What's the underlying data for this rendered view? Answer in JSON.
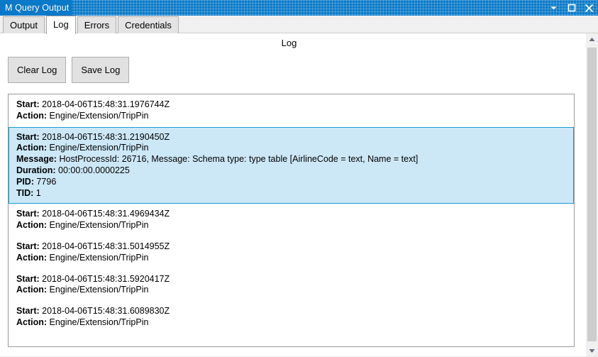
{
  "window": {
    "title": "M Query Output",
    "controls": [
      {
        "name": "minimize",
        "glyph": "chevron-down"
      },
      {
        "name": "maximize",
        "glyph": "square"
      },
      {
        "name": "close",
        "glyph": "x"
      }
    ],
    "colors": {
      "titlebar": "#0a7ac8",
      "titlebar_text": "#ffffff",
      "selection_fill": "#cce8f7",
      "selection_border": "#1d9bd7",
      "button_face": "#e1e1e1",
      "tab_inactive": "#e4e4e4",
      "tab_active": "#ffffff"
    }
  },
  "tabs": [
    {
      "label": "Output",
      "active": false
    },
    {
      "label": "Log",
      "active": true
    },
    {
      "label": "Errors",
      "active": false
    },
    {
      "label": "Credentials",
      "active": false
    }
  ],
  "panel": {
    "title": "Log",
    "buttons": [
      {
        "label": "Clear Log",
        "name": "clear-log-button"
      },
      {
        "label": "Save Log",
        "name": "save-log-button"
      }
    ]
  },
  "log_entries": [
    {
      "selected": false,
      "fields": [
        {
          "key": "Start:",
          "value": "2018-04-06T15:48:31.1976744Z"
        },
        {
          "key": "Action:",
          "value": "Engine/Extension/TripPin"
        }
      ]
    },
    {
      "selected": true,
      "fields": [
        {
          "key": "Start:",
          "value": "2018-04-06T15:48:31.2190450Z"
        },
        {
          "key": "Action:",
          "value": "Engine/Extension/TripPin"
        },
        {
          "key": "Message:",
          "value": "HostProcessId: 26716, Message: Schema type: type table [AirlineCode = text, Name = text]"
        },
        {
          "key": "Duration:",
          "value": "00:00:00.0000225"
        },
        {
          "key": "PID:",
          "value": "7796"
        },
        {
          "key": "TID:",
          "value": "1"
        }
      ]
    },
    {
      "selected": false,
      "fields": [
        {
          "key": "Start:",
          "value": "2018-04-06T15:48:31.4969434Z"
        },
        {
          "key": "Action:",
          "value": "Engine/Extension/TripPin"
        }
      ]
    },
    {
      "selected": false,
      "fields": [
        {
          "key": "Start:",
          "value": "2018-04-06T15:48:31.5014955Z"
        },
        {
          "key": "Action:",
          "value": "Engine/Extension/TripPin"
        }
      ]
    },
    {
      "selected": false,
      "fields": [
        {
          "key": "Start:",
          "value": "2018-04-06T15:48:31.5920417Z"
        },
        {
          "key": "Action:",
          "value": "Engine/Extension/TripPin"
        }
      ]
    },
    {
      "selected": false,
      "fields": [
        {
          "key": "Start:",
          "value": "2018-04-06T15:48:31.6089830Z"
        },
        {
          "key": "Action:",
          "value": "Engine/Extension/TripPin"
        }
      ]
    }
  ],
  "scrollbar": {
    "up_icon": "scroll-up-arrow",
    "down_icon": "scroll-down-arrow",
    "thumb": "scroll-thumb"
  }
}
